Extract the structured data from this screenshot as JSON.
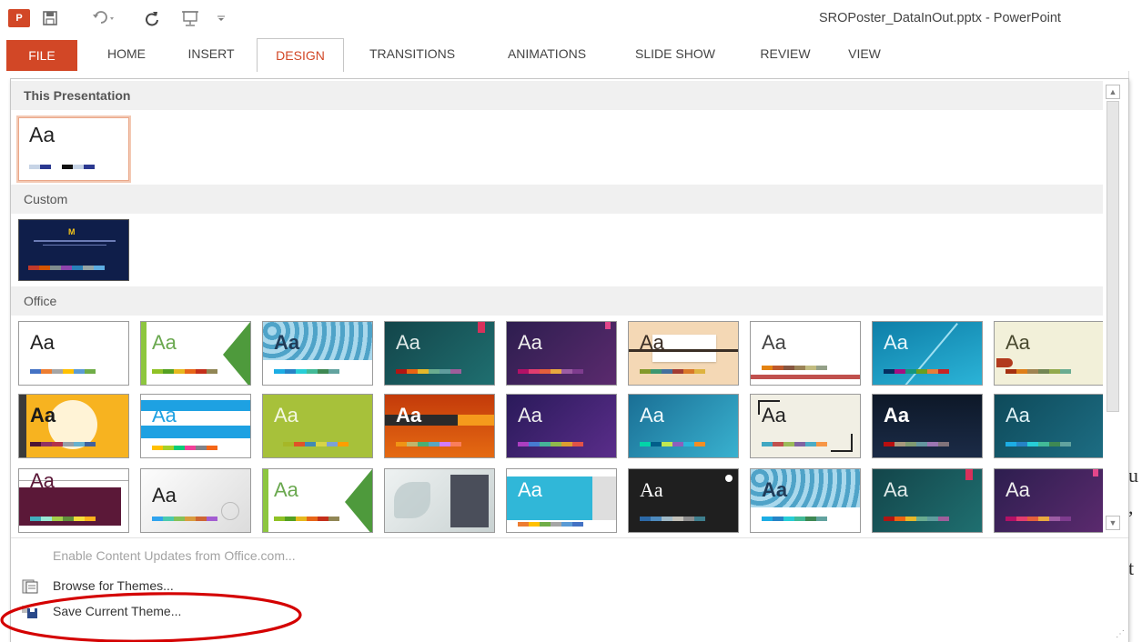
{
  "window": {
    "title": "SROPoster_DataInOut.pptx - PowerPoint",
    "app_logo": "P",
    "qat": {
      "save_icon": "save-icon",
      "undo_icon": "undo-icon",
      "redo_icon": "redo-icon",
      "present_icon": "present-from-start-icon",
      "customize_icon": "customize-qat-icon"
    }
  },
  "ribbon": {
    "tabs": [
      "FILE",
      "HOME",
      "INSERT",
      "DESIGN",
      "TRANSITIONS",
      "ANIMATIONS",
      "SLIDE SHOW",
      "REVIEW",
      "VIEW"
    ],
    "active_tab": "DESIGN"
  },
  "gallery": {
    "sections": [
      {
        "name": "This Presentation",
        "themes": [
          {
            "preview_text": "Aa"
          }
        ]
      },
      {
        "name": "Custom",
        "themes": [
          {
            "preview_text": "M"
          }
        ]
      },
      {
        "name": "Office",
        "themes": [
          {
            "preview_text": "Aa"
          },
          {
            "preview_text": "Aa"
          },
          {
            "preview_text": "Aa"
          },
          {
            "preview_text": "Aa"
          },
          {
            "preview_text": "Aa"
          },
          {
            "preview_text": "Aa"
          },
          {
            "preview_text": "Aa"
          },
          {
            "preview_text": "Aa"
          },
          {
            "preview_text": "Aa"
          },
          {
            "preview_text": "Aa"
          },
          {
            "preview_text": "Aa"
          },
          {
            "preview_text": "Aa"
          },
          {
            "preview_text": "Aa"
          },
          {
            "preview_text": "Aa"
          },
          {
            "preview_text": "Aa"
          },
          {
            "preview_text": "Aa"
          },
          {
            "preview_text": "Aa"
          },
          {
            "preview_text": "Aa"
          },
          {
            "preview_text": "Aa"
          },
          {
            "preview_text": "Aa"
          },
          {
            "preview_text": "Aa"
          },
          {
            "preview_text": ""
          },
          {
            "preview_text": "Aa"
          },
          {
            "preview_text": "Aa"
          },
          {
            "preview_text": "Aa"
          },
          {
            "preview_text": "Aa"
          },
          {
            "preview_text": "Aa"
          }
        ]
      }
    ],
    "commands": [
      {
        "label": "Enable Content Updates from Office.com...",
        "enabled": false
      },
      {
        "label": "Browse for Themes...",
        "enabled": true,
        "icon": "browse-themes-icon"
      },
      {
        "label": "Save Current Theme...",
        "enabled": true,
        "icon": "save-theme-icon"
      }
    ]
  },
  "background_glyphs": [
    "u",
    ",",
    "t"
  ],
  "colors": {
    "accent": "#d24726",
    "annotation": "#d40000"
  }
}
